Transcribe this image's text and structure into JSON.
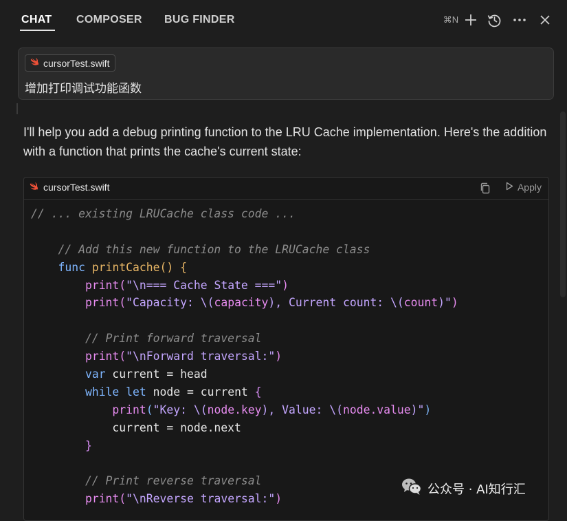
{
  "tabs": [
    {
      "label": "CHAT",
      "active": true
    },
    {
      "label": "COMPOSER",
      "active": false
    },
    {
      "label": "BUG FINDER",
      "active": false
    }
  ],
  "header": {
    "new_chat_shortcut": "⌘N",
    "icons": [
      "plus-icon",
      "history-icon",
      "more-icon",
      "close-icon"
    ]
  },
  "context": {
    "file_name": "cursorTest.swift",
    "prompt": "增加打印调试功能函数"
  },
  "response": {
    "text": "I'll help you add a debug printing function to the LRU Cache implementation. Here's the addition with a function that prints the cache's current state:"
  },
  "code_block": {
    "file_name": "cursorTest.swift",
    "apply_label": "Apply",
    "lines": [
      [
        {
          "t": "// ... existing LRUCache class code ...",
          "c": "comment"
        }
      ],
      [],
      [
        {
          "t": "    // Add this new function to the LRUCache class",
          "c": "comment"
        }
      ],
      [
        {
          "t": "    ",
          "c": "plain"
        },
        {
          "t": "func",
          "c": "kw"
        },
        {
          "t": " ",
          "c": "plain"
        },
        {
          "t": "printCache() {",
          "c": "fn"
        }
      ],
      [
        {
          "t": "        ",
          "c": "plain"
        },
        {
          "t": "print(",
          "c": "call"
        },
        {
          "t": "\"\\n=== Cache State ===\"",
          "c": "str"
        },
        {
          "t": ")",
          "c": "call"
        }
      ],
      [
        {
          "t": "        ",
          "c": "plain"
        },
        {
          "t": "print(",
          "c": "call"
        },
        {
          "t": "\"Capacity: \\(",
          "c": "str"
        },
        {
          "t": "capacity",
          "c": "call"
        },
        {
          "t": "), Current count: \\(",
          "c": "str"
        },
        {
          "t": "count",
          "c": "call"
        },
        {
          "t": ")\"",
          "c": "str"
        },
        {
          "t": ")",
          "c": "call"
        }
      ],
      [],
      [
        {
          "t": "        // Print forward traversal",
          "c": "comment"
        }
      ],
      [
        {
          "t": "        ",
          "c": "plain"
        },
        {
          "t": "print(",
          "c": "call"
        },
        {
          "t": "\"\\nForward traversal:\"",
          "c": "str"
        },
        {
          "t": ")",
          "c": "call"
        }
      ],
      [
        {
          "t": "        ",
          "c": "plain"
        },
        {
          "t": "var",
          "c": "kw"
        },
        {
          "t": " current = head",
          "c": "plain"
        }
      ],
      [
        {
          "t": "        ",
          "c": "plain"
        },
        {
          "t": "while",
          "c": "kw"
        },
        {
          "t": " ",
          "c": "plain"
        },
        {
          "t": "let",
          "c": "kw"
        },
        {
          "t": " node = current ",
          "c": "plain"
        },
        {
          "t": "{",
          "c": "brace"
        }
      ],
      [
        {
          "t": "            ",
          "c": "plain"
        },
        {
          "t": "print",
          "c": "call"
        },
        {
          "t": "(",
          "c": "brace2"
        },
        {
          "t": "\"Key: \\(",
          "c": "str"
        },
        {
          "t": "node.key",
          "c": "call"
        },
        {
          "t": "), Value: \\(",
          "c": "str"
        },
        {
          "t": "node.value",
          "c": "call"
        },
        {
          "t": ")\"",
          "c": "str"
        },
        {
          "t": ")",
          "c": "brace2"
        }
      ],
      [
        {
          "t": "            current = node.next",
          "c": "plain"
        }
      ],
      [
        {
          "t": "        ",
          "c": "plain"
        },
        {
          "t": "}",
          "c": "brace"
        }
      ],
      [],
      [
        {
          "t": "        // Print reverse traversal",
          "c": "comment"
        }
      ],
      [
        {
          "t": "        ",
          "c": "plain"
        },
        {
          "t": "print(",
          "c": "call"
        },
        {
          "t": "\"\\nReverse traversal:\"",
          "c": "str"
        },
        {
          "t": ")",
          "c": "call"
        }
      ]
    ]
  },
  "watermark": {
    "text": "公众号 · AI知行汇"
  },
  "colors": {
    "background": "#1e1e1e",
    "code_background": "#181818",
    "swift_icon": "#f05138"
  }
}
